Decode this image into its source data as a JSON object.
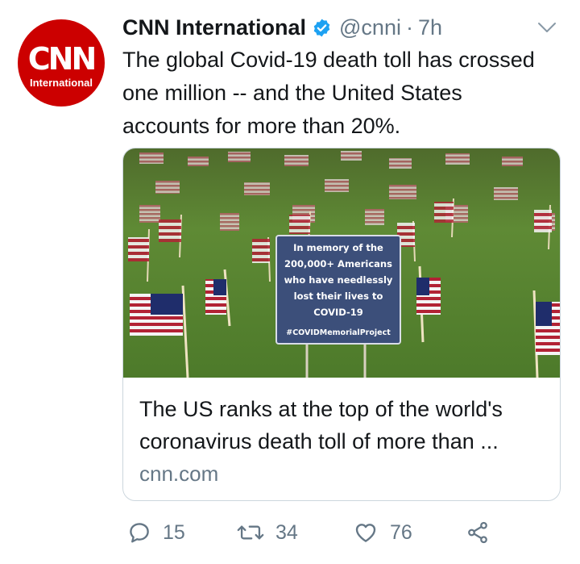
{
  "avatar": {
    "logo_text": "CNN",
    "sub_text": "International"
  },
  "header": {
    "name": "CNN International",
    "handle": "@cnni",
    "separator": "·",
    "time": "7h"
  },
  "tweet": {
    "text": "The global Covid-19 death toll has crossed one million -- and the United States accounts for more than 20%."
  },
  "card": {
    "image_sign": {
      "lines": [
        "In memory of the",
        "200,000+ Americans",
        "who have needlessly",
        "lost their lives to",
        "COVID-19"
      ],
      "hashtag": "#COVIDMemorialProject"
    },
    "title": "The US ranks at the top of the world's coronavirus death toll of more than ...",
    "domain": "cnn.com"
  },
  "actions": {
    "reply_count": "15",
    "retweet_count": "34",
    "like_count": "76"
  },
  "colors": {
    "brand_red": "#cc0000",
    "verified_blue": "#1da1f2",
    "muted_gray": "#657786",
    "text": "#14171a",
    "border": "#ccd6dd"
  },
  "icons": [
    "verified-badge-icon",
    "chevron-down-icon",
    "reply-icon",
    "retweet-icon",
    "like-icon",
    "share-icon"
  ]
}
